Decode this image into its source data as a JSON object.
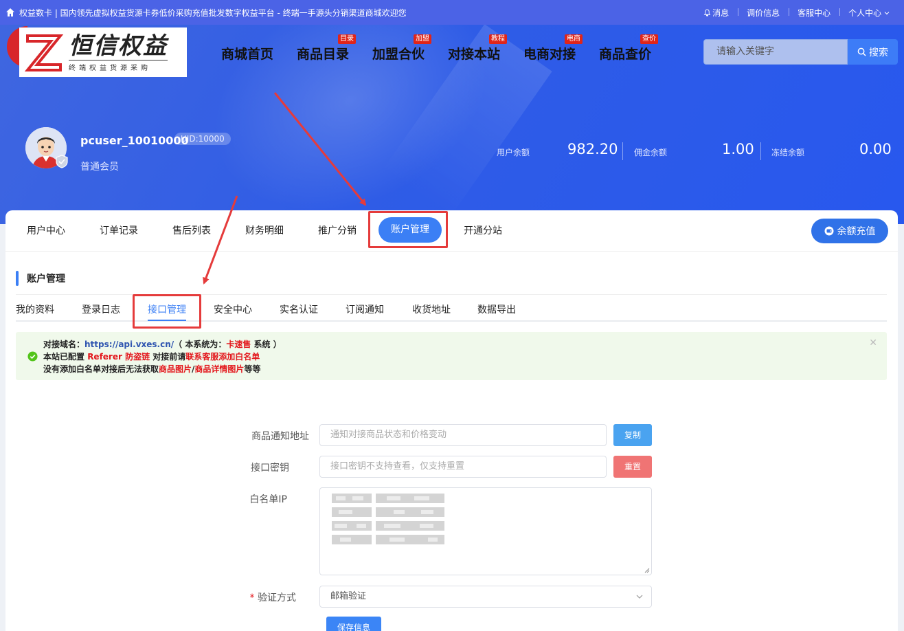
{
  "topbar": {
    "site_text": "权益数卡 | 国内领先虚拟权益货源卡券低价采购充值批发数字权益平台 - 终端一手源头分销渠道商城欢迎您",
    "links": [
      "消息",
      "调价信息",
      "客服中心",
      "个人中心"
    ]
  },
  "logo": {
    "brand": "恒信权益",
    "sub": "终端权益货源采购"
  },
  "nav": [
    {
      "label": "商城首页",
      "badge": ""
    },
    {
      "label": "商品目录",
      "badge": "目录"
    },
    {
      "label": "加盟合伙",
      "badge": "加盟"
    },
    {
      "label": "对接本站",
      "badge": "教程"
    },
    {
      "label": "电商对接",
      "badge": "电商"
    },
    {
      "label": "商品查价",
      "badge": "查价"
    }
  ],
  "search": {
    "placeholder": "请输入关键字",
    "button": "搜索"
  },
  "user": {
    "name": "pcuser_10010000",
    "uid": "UID:10000",
    "level": "普通会员"
  },
  "stats": [
    {
      "label": "用户余额",
      "value": "982.20"
    },
    {
      "label": "佣金余额",
      "value": "1.00"
    },
    {
      "label": "冻结余额",
      "value": "0.00"
    }
  ],
  "main_tabs": [
    "用户中心",
    "订单记录",
    "售后列表",
    "财务明细",
    "推广分销",
    "账户管理",
    "开通分站"
  ],
  "recharge_button": "余额充值",
  "section_title": "账户管理",
  "sub_tabs": [
    "我的资料",
    "登录日志",
    "接口管理",
    "安全中心",
    "实名认证",
    "订阅通知",
    "收货地址",
    "数据导出"
  ],
  "alert": {
    "l1_a": "对接域名：",
    "l1_url": "https://api.vxes.cn/",
    "l1_b": "（ 本系统为：",
    "l1_sys": "卡速售",
    "l1_c": " 系统 ）",
    "l2_a": "本站已配置 ",
    "l2_ref": "Referer 防盗链",
    "l2_b": " 对接前请",
    "l2_c": "联系客服添加白名单",
    "l3_a": "没有添加白名单对接后无法获取",
    "l3_b": "商品图片",
    "l3_c": "/",
    "l3_d": "商品详情图片",
    "l3_e": "等等"
  },
  "form": {
    "notify_label": "商品通知地址",
    "notify_placeholder": "通知对接商品状态和价格变动",
    "copy_button": "复制",
    "key_label": "接口密钥",
    "key_placeholder": "接口密钥不支持查看，仅支持重置",
    "reset_button": "重置",
    "whitelist_label": "白名单IP",
    "verify_label": "验证方式",
    "verify_value": "邮箱验证",
    "save_button": "保存信息"
  },
  "colors": {
    "primary": "#3b7ff5",
    "banner": "#2f5ce6",
    "highlight": "#e53b3b",
    "reset": "#f07474",
    "copy": "#4aa3f0"
  }
}
